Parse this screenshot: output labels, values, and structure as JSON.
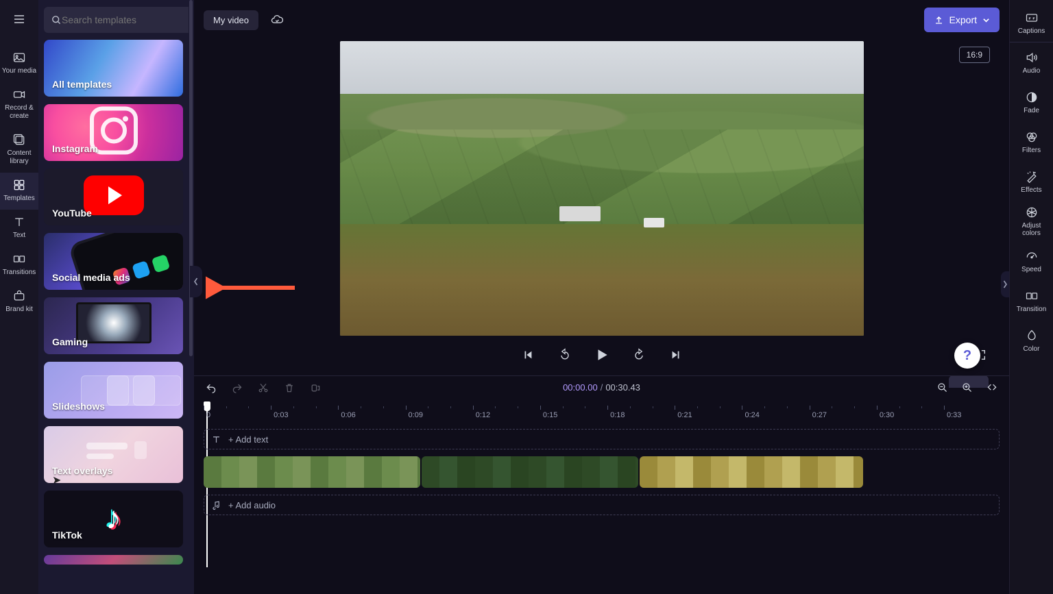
{
  "leftNav": {
    "items": [
      {
        "id": "your-media",
        "label": "Your media"
      },
      {
        "id": "record-create",
        "label": "Record &\ncreate"
      },
      {
        "id": "content-library",
        "label": "Content\nlibrary"
      },
      {
        "id": "templates",
        "label": "Templates"
      },
      {
        "id": "text",
        "label": "Text"
      },
      {
        "id": "transitions",
        "label": "Transitions"
      },
      {
        "id": "brand-kit",
        "label": "Brand kit"
      }
    ],
    "activeIndex": 3
  },
  "search": {
    "placeholder": "Search templates",
    "value": ""
  },
  "templateCards": [
    {
      "id": "all",
      "label": "All templates",
      "bg": "bg-all"
    },
    {
      "id": "instagram",
      "label": "Instagram",
      "bg": "bg-ig"
    },
    {
      "id": "youtube",
      "label": "YouTube",
      "bg": "bg-yt"
    },
    {
      "id": "social-media-ads",
      "label": "Social media ads",
      "bg": "bg-sma"
    },
    {
      "id": "gaming",
      "label": "Gaming",
      "bg": "bg-game"
    },
    {
      "id": "slideshows",
      "label": "Slideshows",
      "bg": "bg-slide"
    },
    {
      "id": "text-overlays",
      "label": "Text overlays",
      "bg": "bg-text"
    },
    {
      "id": "tiktok",
      "label": "TikTok",
      "bg": "bg-tiktok"
    },
    {
      "id": "more",
      "label": "",
      "bg": "bg-last"
    }
  ],
  "topbar": {
    "title": "My video",
    "exportLabel": "Export"
  },
  "viewer": {
    "aspect": "16:9",
    "helpGlyph": "?"
  },
  "timeline": {
    "current": "00:00.00",
    "total": "00:30.43",
    "ticks": [
      "0",
      "0:03",
      "0:06",
      "0:09",
      "0:12",
      "0:15",
      "0:18",
      "0:21",
      "0:24",
      "0:27",
      "0:30",
      "0:33"
    ],
    "addTextLabel": "+ Add text",
    "addAudioLabel": "+ Add audio"
  },
  "rightRail": {
    "items": [
      {
        "id": "captions",
        "label": "Captions"
      },
      {
        "id": "audio",
        "label": "Audio"
      },
      {
        "id": "fade",
        "label": "Fade"
      },
      {
        "id": "filters",
        "label": "Filters"
      },
      {
        "id": "effects",
        "label": "Effects"
      },
      {
        "id": "adjust-colors",
        "label": "Adjust\ncolors"
      },
      {
        "id": "speed",
        "label": "Speed"
      },
      {
        "id": "transition",
        "label": "Transition"
      },
      {
        "id": "color",
        "label": "Color"
      }
    ]
  }
}
